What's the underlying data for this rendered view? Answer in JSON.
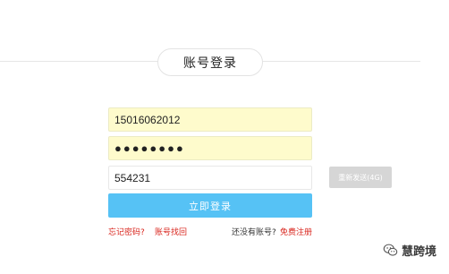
{
  "header": {
    "title": "账号登录"
  },
  "form": {
    "phone_value": "15016062012",
    "password_value": "●●●●●●●●",
    "code_value": "554231",
    "resend_label": "重新发送(4G)",
    "login_label": "立即登录"
  },
  "links": {
    "forgot_password": "忘记密码?",
    "retrieve_account": "账号找回",
    "no_account": "还没有账号?",
    "register": "免费注册"
  },
  "watermark": {
    "text": "慧跨境",
    "icon": "wechat-icon"
  },
  "colors": {
    "accent_blue": "#56c2f5",
    "link_red": "#d9251d",
    "autofill_yellow": "#fefbcc",
    "disabled_gray": "#d6d6d6"
  }
}
